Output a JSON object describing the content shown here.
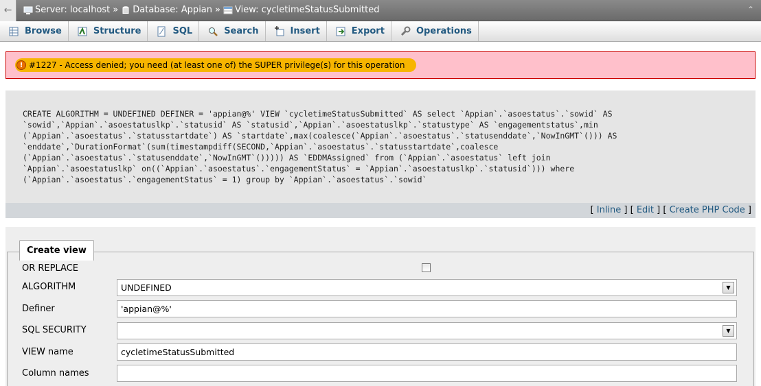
{
  "breadcrumb": {
    "server": "Server: localhost",
    "database": "Database: Appian",
    "view": "View: cycletimeStatusSubmitted",
    "separator": "»"
  },
  "tabs": [
    {
      "label": "Browse",
      "icon": "browse-icon"
    },
    {
      "label": "Structure",
      "icon": "structure-icon"
    },
    {
      "label": "SQL",
      "icon": "sql-icon"
    },
    {
      "label": "Search",
      "icon": "search-icon"
    },
    {
      "label": "Insert",
      "icon": "insert-icon"
    },
    {
      "label": "Export",
      "icon": "export-icon"
    },
    {
      "label": "Operations",
      "icon": "operations-icon"
    }
  ],
  "error": {
    "message": "#1227 - Access denied; you need (at least one of) the SUPER privilege(s) for this operation",
    "highlight_color": "#f7b500"
  },
  "sql": {
    "lines": [
      "CREATE ALGORITHM = UNDEFINED DEFINER = 'appian@%' VIEW `cycletimeStatusSubmitted` AS select `Appian`.`asoestatus`.`sowid` AS",
      "`sowid`,`Appian`.`asoestatuslkp`.`statusid` AS `statusid`,`Appian`.`asoestatuslkp`.`statustype` AS `engagementstatus`,min",
      "(`Appian`.`asoestatus`.`statusstartdate`) AS `startdate`,max(coalesce(`Appian`.`asoestatus`.`statusenddate`,`NowInGMT`())) AS",
      "`enddate`,`DurationFormat`(sum(timestampdiff(SECOND,`Appian`.`asoestatus`.`statusstartdate`,coalesce",
      "(`Appian`.`asoestatus`.`statusenddate`,`NowInGMT`())))) AS `EDDMAssigned` from (`Appian`.`asoestatus` left join",
      "`Appian`.`asoestatuslkp` on((`Appian`.`asoestatus`.`engagementStatus` = `Appian`.`asoestatuslkp`.`statusid`))) where",
      "(`Appian`.`asoestatus`.`engagementStatus` = 1) group by `Appian`.`asoestatus`.`sowid`"
    ]
  },
  "sql_links": {
    "inline": "Inline",
    "edit": "Edit",
    "create_php": "Create PHP Code"
  },
  "form": {
    "legend": "Create view",
    "or_replace_label": "OR REPLACE",
    "or_replace_checked": false,
    "algorithm_label": "ALGORITHM",
    "algorithm_value": "UNDEFINED",
    "definer_label": "Definer",
    "definer_value": "'appian@%'",
    "sql_security_label": "SQL SECURITY",
    "sql_security_value": "",
    "view_name_label": "VIEW name",
    "view_name_value": "cycletimeStatusSubmitted",
    "column_names_label": "Column names",
    "column_names_value": ""
  },
  "colors": {
    "tab_text": "#235a81",
    "error_bg": "#ffc0cb",
    "sql_bg": "#e5e5e5",
    "keyword": "#990099"
  }
}
